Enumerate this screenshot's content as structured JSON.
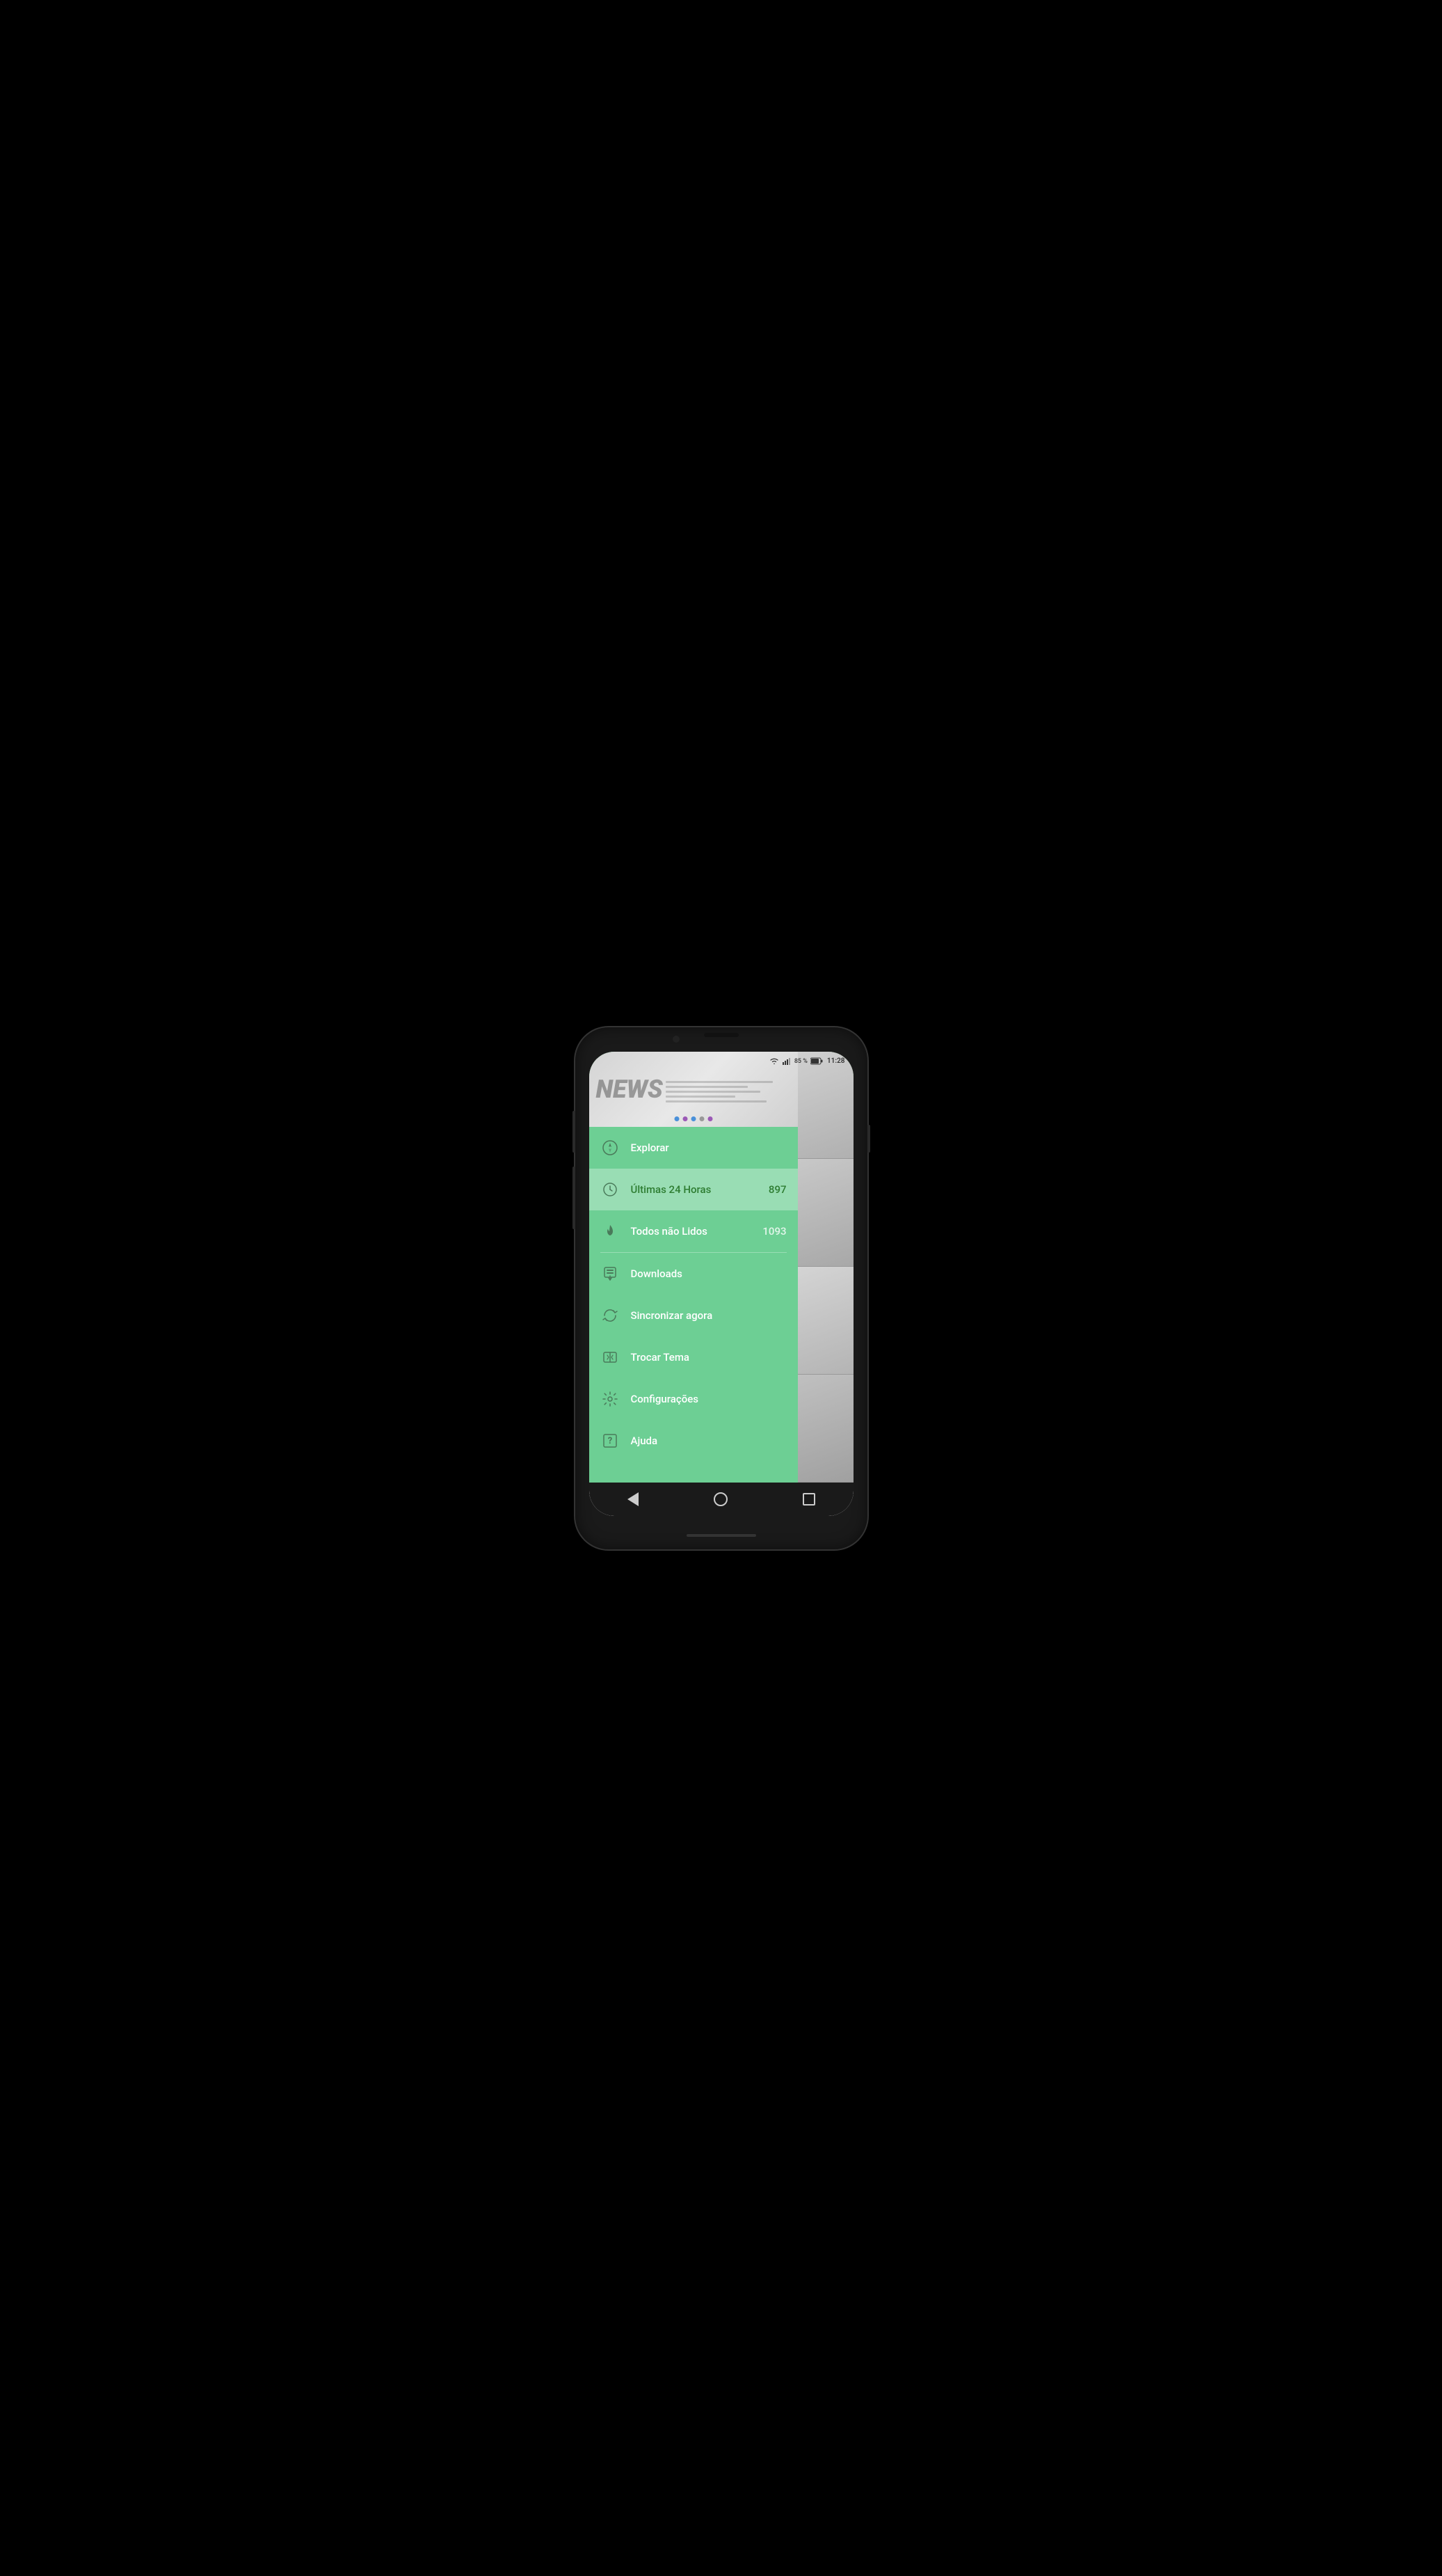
{
  "statusBar": {
    "wifi": "wifi",
    "signal": "signal",
    "battery": "85 %",
    "time": "11:28"
  },
  "header": {
    "logo": "NEWS",
    "moreIcon": "⋮"
  },
  "bannerDots": [
    {
      "color": "#4a90d9",
      "active": false
    },
    {
      "color": "#9b59b6",
      "active": false
    },
    {
      "color": "#4a90d9",
      "active": false
    },
    {
      "color": "#888",
      "active": false
    },
    {
      "color": "#9b59b6",
      "active": false
    }
  ],
  "drawer": {
    "items": [
      {
        "id": "explorar",
        "label": "Explorar",
        "icon": "compass",
        "badge": "",
        "active": false
      },
      {
        "id": "ultimas24h",
        "label": "Últimas 24 Horas",
        "icon": "clock",
        "badge": "897",
        "active": true
      },
      {
        "id": "todos-nao-lidos",
        "label": "Todos não Lidos",
        "icon": "fire",
        "badge": "1093",
        "active": false
      },
      {
        "id": "downloads",
        "label": "Downloads",
        "icon": "download",
        "badge": "",
        "active": false
      },
      {
        "id": "sincronizar",
        "label": "Sincronizar agora",
        "icon": "sync",
        "badge": "",
        "active": false
      },
      {
        "id": "trocar-tema",
        "label": "Trocar Tema",
        "icon": "theme",
        "badge": "",
        "active": false
      },
      {
        "id": "configuracoes",
        "label": "Configurações",
        "icon": "gear",
        "badge": "",
        "active": false
      },
      {
        "id": "ajuda",
        "label": "Ajuda",
        "icon": "help",
        "badge": "",
        "active": false
      }
    ]
  },
  "navBar": {
    "backLabel": "back",
    "homeLabel": "home",
    "recentsLabel": "recents"
  }
}
